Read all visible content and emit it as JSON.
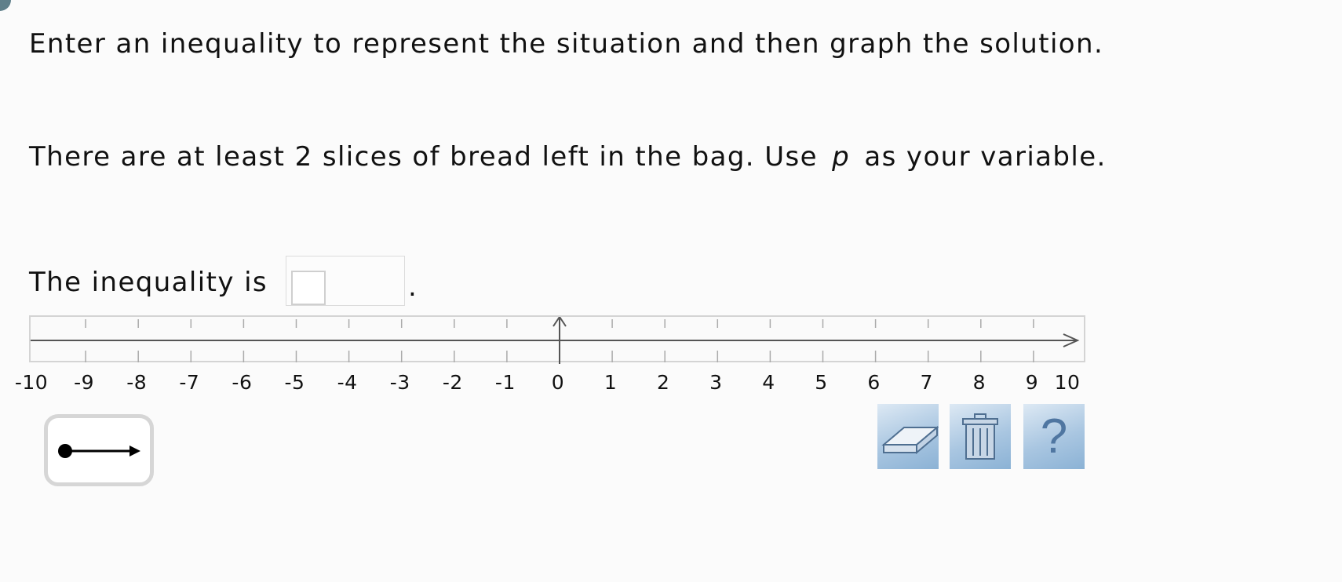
{
  "question": {
    "instruction": "Enter an inequality to represent the situation and then graph the solution.",
    "situation_before": "There are at least 2 slices of bread left in the bag. Use",
    "variable": "p",
    "situation_after": "as your variable.",
    "inequality_label": "The inequality is",
    "inequality_value": "",
    "period": "."
  },
  "number_line": {
    "min": -10,
    "max": 10,
    "step": 1,
    "tick_labels": [
      "-10",
      "-9",
      "-8",
      "-7",
      "-6",
      "-5",
      "-4",
      "-3",
      "-2",
      "-1",
      "0",
      "1",
      "2",
      "3",
      "4",
      "5",
      "6",
      "7",
      "8",
      "9",
      "10"
    ]
  },
  "tools": {
    "ray_tool": "closed-circle-ray-right-icon",
    "eraser": "eraser-icon",
    "trash": "trash-icon",
    "help_label": "?"
  },
  "colors": {
    "tool_button_gradient": [
      "#dde9f4",
      "#8bb2d5"
    ],
    "icon_blue": "#4f76a1",
    "axis": "#555555"
  }
}
